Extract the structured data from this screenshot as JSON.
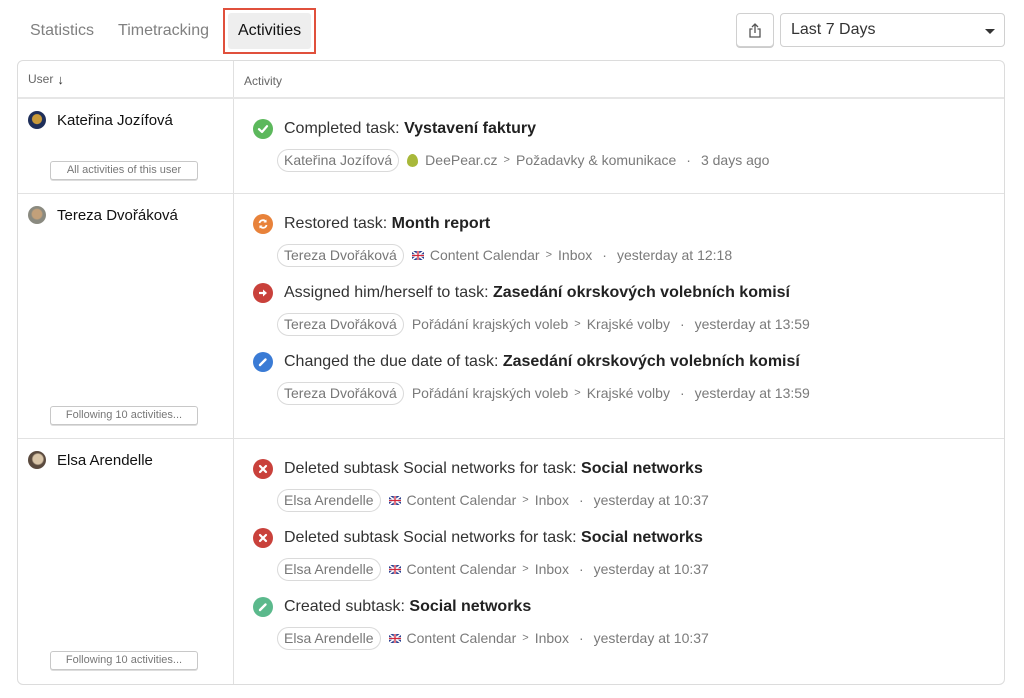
{
  "tabs": [
    {
      "label": "Statistics",
      "active": false
    },
    {
      "label": "Timetracking",
      "active": false
    },
    {
      "label": "Activities",
      "active": true
    }
  ],
  "toolbar": {
    "export_icon": "share-export-icon",
    "period_value": "Last 7 Days"
  },
  "table": {
    "headers": {
      "user": "User",
      "user_sort": "↓",
      "activity": "Activity"
    },
    "groups": [
      {
        "user": "Kateřina Jozífová",
        "button": "All activities of this user",
        "activities": [
          {
            "icon": "check-circle-icon",
            "icon_color": "#5cb85c",
            "action": "Completed task: ",
            "task": "Vystavení faktury",
            "user_pill": "Kateřina Jozífová",
            "project_icon": "pear-icon",
            "project": "DeePear.cz",
            "section": "Požadavky & komunikace",
            "time": "3 days ago"
          }
        ]
      },
      {
        "user": "Tereza Dvořáková",
        "button": "Following 10 activities...",
        "activities": [
          {
            "icon": "restore-icon",
            "icon_color": "#e8823a",
            "action": "Restored task: ",
            "task": "Month report",
            "user_pill": "Tereza Dvořáková",
            "project_icon": "uk-flag-icon",
            "project": "Content Calendar",
            "section": "Inbox",
            "time": "yesterday at 12:18"
          },
          {
            "icon": "arrow-right-circle-icon",
            "icon_color": "#c9413b",
            "action": "Assigned him/herself to task: ",
            "task": "Zasedání okrskových volebních komisí",
            "user_pill": "Tereza Dvořáková",
            "project_icon": "",
            "project": "Pořádání krajských voleb",
            "section": "Krajské volby",
            "time": "yesterday at 13:59"
          },
          {
            "icon": "pencil-circle-icon",
            "icon_color": "#3a7bd5",
            "action": "Changed the due date of task: ",
            "task": "Zasedání okrskových volebních komisí",
            "user_pill": "Tereza Dvořáková",
            "project_icon": "",
            "project": "Pořádání krajských voleb",
            "section": "Krajské volby",
            "time": "yesterday at 13:59"
          }
        ]
      },
      {
        "user": "Elsa Arendelle",
        "button": "Following 10 activities...",
        "activities": [
          {
            "icon": "x-circle-icon",
            "icon_color": "#c9413b",
            "action": "Deleted subtask Social networks for task: ",
            "task": "Social networks",
            "user_pill": "Elsa Arendelle",
            "project_icon": "uk-flag-icon",
            "project": "Content Calendar",
            "section": "Inbox",
            "time": "yesterday at 10:37"
          },
          {
            "icon": "x-circle-icon",
            "icon_color": "#c9413b",
            "action": "Deleted subtask Social networks for task: ",
            "task": "Social networks",
            "user_pill": "Elsa Arendelle",
            "project_icon": "uk-flag-icon",
            "project": "Content Calendar",
            "section": "Inbox",
            "time": "yesterday at 10:37"
          },
          {
            "icon": "pencil-circle-icon",
            "icon_color": "#5bb98c",
            "action": "Created subtask: ",
            "task": "Social networks",
            "user_pill": "Elsa Arendelle",
            "project_icon": "uk-flag-icon",
            "project": "Content Calendar",
            "section": "Inbox",
            "time": "yesterday at 10:37"
          }
        ]
      }
    ]
  }
}
